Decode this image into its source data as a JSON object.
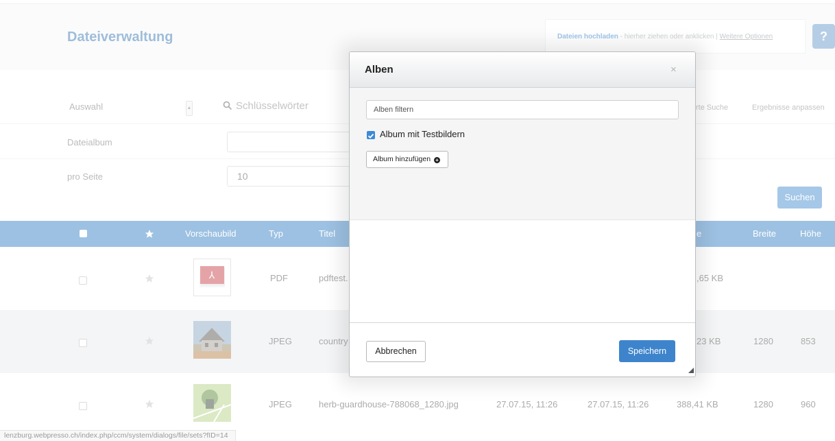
{
  "header": {
    "title": "Dateiverwaltung",
    "upload_strong": "Dateien hochladen",
    "upload_text": " - hierher ziehen oder anklicken | ",
    "upload_more": "Weitere Optionen",
    "help_label": "?"
  },
  "filters": {
    "auswahl": "Auswahl",
    "keywords_placeholder": "Schlüsselwörter",
    "advanced_search": "rte Suche",
    "customize_results": "Ergebnisse anpassen",
    "album_label": "Dateialbum",
    "per_page_label": "pro Seite",
    "per_page_value": "10",
    "search_button": "Suchen"
  },
  "table": {
    "columns": {
      "preview": "Vorschaubild",
      "type": "Typ",
      "title": "Titel",
      "size": "e",
      "width": "Breite",
      "height": "Höhe"
    },
    "rows": [
      {
        "type": "PDF",
        "title": "pdftest.",
        "added": "",
        "modified": "",
        "size": ",65 KB",
        "width": "",
        "height": ""
      },
      {
        "type": "JPEG",
        "title": "country",
        "added": "",
        "modified": "",
        "size": "23 KB",
        "width": "1280",
        "height": "853"
      },
      {
        "type": "JPEG",
        "title": "herb-guardhouse-788068_1280.jpg",
        "added": "27.07.15, 11:26",
        "modified": "27.07.15, 11:26",
        "size": "388,41 KB",
        "width": "1280",
        "height": "960"
      }
    ]
  },
  "status_bar": "lenzburg.webpresso.ch/index.php/ccm/system/dialogs/file/sets?fID=14",
  "modal": {
    "title": "Alben",
    "close": "×",
    "filter_placeholder": "Alben filtern",
    "album_name": "Album mit Testbildern",
    "add_album": "Album hinzufügen",
    "cancel": "Abbrechen",
    "save": "Speichern"
  },
  "colors": {
    "accent": "#3a82c4",
    "title": "#3d7ab2",
    "primary_button": "#3d84cc"
  }
}
